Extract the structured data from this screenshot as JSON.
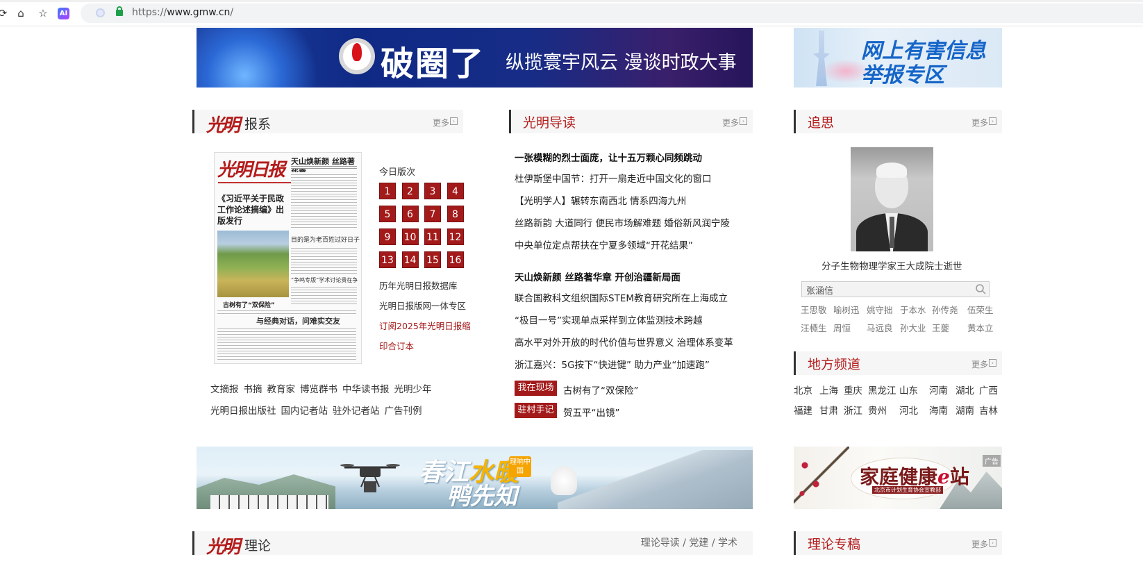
{
  "browser": {
    "url_scheme": "https://",
    "url_host": "www.gmw.cn",
    "url_path": "/",
    "ai_label": "AI"
  },
  "banners": {
    "top_title": "破圈了",
    "top_slogan": "纵揽寰宇风云  漫谈时政大事",
    "report_line1": "网上有害信息",
    "report_line2": "举报专区",
    "river_line1_a": "春江",
    "river_line1_b": "水暖",
    "river_line2": "鸭先知",
    "river_badge": "理响中国",
    "health_title_a": "家庭健康",
    "health_title_e": "e",
    "health_title_b": "站",
    "health_sub": "北京市计划生育协会宣教部",
    "health_ad": "广告"
  },
  "sections": {
    "gm_logo": "光明",
    "baoxi": "报系",
    "daodu": "光明导读",
    "zhuisi": "追思",
    "difang": "地方频道",
    "lilun": "理论",
    "lilun_zhuangao": "理论专稿",
    "more": "更多",
    "theory_links": "理论导读 / 党建 / 学术"
  },
  "newspaper": {
    "masthead": "光明日报",
    "headline_top": "天山焕新颜  丝路著华章",
    "lead": "《习近平关于民政工作论述摘编》出版发行",
    "mid": "目的是为老百姓过好日子",
    "mid2": "“争鸣专版”学术讨论贵在争鸣",
    "small": "古树有了“双保险”",
    "bottom": "与经典对话，问难实交友",
    "editions_label": "今日版次",
    "editions": [
      "1",
      "2",
      "3",
      "4",
      "5",
      "6",
      "7",
      "8",
      "9",
      "10",
      "11",
      "12",
      "13",
      "14",
      "15",
      "16"
    ],
    "links": [
      "历年光明日报数据库",
      "光明日报版网一体专区"
    ],
    "subscribe1": "订阅2025年光明日报缩",
    "subscribe2": "印合订本",
    "sub_row1": [
      "文摘报",
      "书摘",
      "教育家",
      "博览群书",
      "中华读书报",
      "光明少年"
    ],
    "sub_row2": [
      "光明日报出版社",
      "国内记者站",
      "驻外记者站",
      "广告刊例"
    ]
  },
  "reading": {
    "group1_headline": "一张模糊的烈士面庞，让十五万颗心同频跳动",
    "group1": [
      "杜伊斯堡中国节：打开一扇走近中国文化的窗口",
      "【光明学人】辗转东南西北 情系四海九州",
      "丝路新韵 大道同行 便民市场解难题 婚俗新风润宁陵",
      "中央单位定点帮扶在宁夏多领域“开花结果”"
    ],
    "group2_headline": "天山焕新颜 丝路著华章 开创治疆新局面",
    "group2": [
      "联合国教科文组织国际STEM教育研究所在上海成立",
      "“极目一号”实现单点采样到立体监测技术跨越",
      "高水平对外开放的时代价值与世界意义 治理体系变革",
      "浙江嘉兴：5G按下“快进键” 助力产业“加速跑”"
    ],
    "tag1": "我在现场",
    "tag1_text": "古树有了“双保险”",
    "tag2": "驻村手记",
    "tag2_text": "贺五平“出镜”"
  },
  "memorial": {
    "caption": "分子生物物理学家王大成院士逝世",
    "search_value": "张涵信",
    "names_row1": [
      "王思敬",
      "喻树迅",
      "姚守拙",
      "于本水",
      "孙传尧",
      "伍荣生"
    ],
    "names_row2": [
      "汪槱生",
      "周恒",
      "马远良",
      "孙大业",
      "王夔",
      "黄本立"
    ]
  },
  "local": {
    "row1": [
      "北京",
      "上海",
      "重庆",
      "黑龙江",
      "山东",
      "河南",
      "湖北",
      "广西"
    ],
    "row2": [
      "福建",
      "甘肃",
      "浙江",
      "贵州",
      "河北",
      "海南",
      "湖南",
      "吉林"
    ]
  }
}
